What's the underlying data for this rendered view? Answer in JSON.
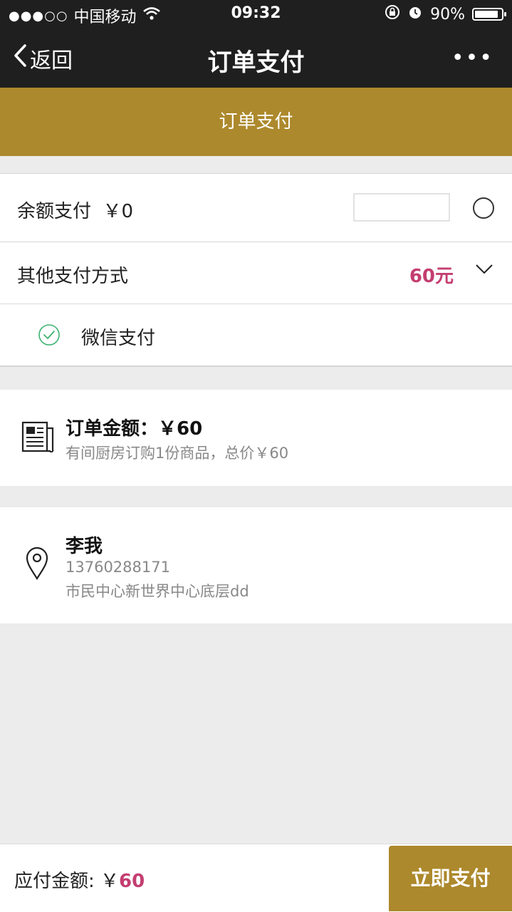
{
  "status_bar": {
    "carrier": "中国移动",
    "signal_dots": "●●●○○",
    "time": "09:32",
    "battery": "90%",
    "battery_level": 0.9
  },
  "nav": {
    "back_label": "返回",
    "title": "订单支付",
    "more_label": "•••"
  },
  "banner": {
    "text": "订单支付"
  },
  "payment": {
    "balance_label": "余额支付",
    "balance_value": "￥0",
    "balance_input_value": "",
    "other_label": "其他支付方式",
    "other_amount": "60元",
    "wechat_label": "微信支付"
  },
  "order": {
    "title_label": "订单金额：",
    "title_value": "￥60",
    "description": "有间厨房订购1份商品，总价￥60"
  },
  "address": {
    "name": "李我",
    "phone": "13760288171",
    "address": "市民中心新世界中心底层dd"
  },
  "footer": {
    "due_label": "应付金额: ￥",
    "due_value": "60",
    "pay_button": "立即支付"
  },
  "colors": {
    "brand_gold": "#ad892d",
    "accent_pink": "#c43e70",
    "wechat_green": "#3cb371",
    "header_dark": "#1f1f1f"
  }
}
